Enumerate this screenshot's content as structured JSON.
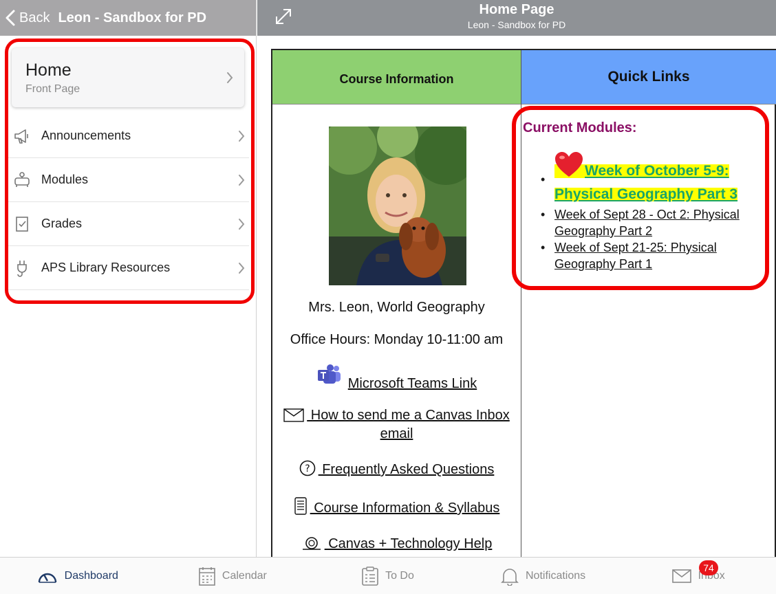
{
  "left_header": {
    "back_label": "Back",
    "title": "Leon - Sandbox for PD"
  },
  "home_card": {
    "title": "Home",
    "subtitle": "Front Page"
  },
  "nav": {
    "items": [
      {
        "label": "Announcements",
        "icon": "megaphone-icon"
      },
      {
        "label": "Modules",
        "icon": "modules-icon"
      },
      {
        "label": "Grades",
        "icon": "grades-icon"
      },
      {
        "label": "APS Library Resources",
        "icon": "plug-icon"
      }
    ]
  },
  "right_header": {
    "title": "Home Page",
    "subtitle": "Leon - Sandbox for PD"
  },
  "page": {
    "course_info_heading": "Course Information",
    "quick_links_heading": "Quick Links",
    "teacher_name": "Mrs. Leon, World Geography",
    "office_hours": "Office Hours:  Monday 10-11:00 am",
    "links": [
      {
        "label": "Microsoft Teams Link",
        "icon": "teams-icon"
      },
      {
        "label": " How to send me a Canvas Inbox email",
        "icon": "envelope-icon"
      },
      {
        "label": " Frequently Asked Questions",
        "icon": "question-circle-icon"
      },
      {
        "label": " Course Information & Syllabus",
        "icon": "document-icon"
      },
      {
        "label": " Canvas + Technology Help",
        "icon": "help-ring-icon"
      }
    ],
    "modules_title": "Current Modules:",
    "modules": [
      {
        "label": "Week of October 5-9: Physical Geography Part 3",
        "featured": true
      },
      {
        "label": "Week of Sept 28 - Oct 2: Physical Geography Part 2"
      },
      {
        "label": "Week of Sept 21-25: Physical Geography Part 1"
      }
    ]
  },
  "tab_bar": {
    "tabs": [
      {
        "label": "Dashboard",
        "icon": "dashboard-gauge-icon",
        "active": true
      },
      {
        "label": "Calendar",
        "icon": "calendar-icon"
      },
      {
        "label": "To Do",
        "icon": "clipboard-icon"
      },
      {
        "label": "Notifications",
        "icon": "bell-icon"
      },
      {
        "label": "Inbox",
        "icon": "inbox-envelope-icon"
      }
    ],
    "inbox_badge": "74"
  },
  "colors": {
    "course_info_header": "#8ed071",
    "quick_links_header": "#68a2fb",
    "annotation_red": "#f10000",
    "modules_title": "#8b1065",
    "featured_link": "#1aa567",
    "featured_highlight": "#ffff00"
  }
}
